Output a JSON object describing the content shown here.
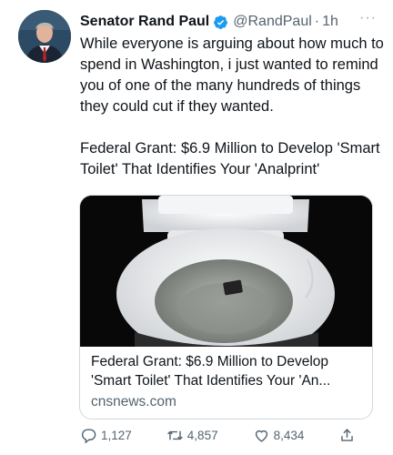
{
  "author": {
    "name": "Senator Rand Paul",
    "handle": "@RandPaul",
    "separator": "·",
    "time": "1h"
  },
  "more_label": "···",
  "tweet": {
    "paragraph1": "While everyone is arguing about how much to spend in Washington, i just wanted to remind you of one of the many hundreds of things they could cut if they wanted.",
    "paragraph2": "Federal Grant: $6.9 Million to Develop 'Smart Toilet' That Identifies Your 'Analprint'"
  },
  "card": {
    "title": "Federal Grant: $6.9 Million to Develop 'Smart Toilet' That Identifies Your 'An...",
    "domain": "cnsnews.com"
  },
  "actions": {
    "replies": "1,127",
    "retweets": "4,857",
    "likes": "8,434"
  },
  "colors": {
    "verified": "#1d9bf0",
    "text": "#0f1419",
    "secondary": "#536471",
    "border": "#cfd9de"
  },
  "icons": [
    "verified-badge-icon",
    "reply-icon",
    "retweet-icon",
    "like-icon",
    "share-icon"
  ]
}
